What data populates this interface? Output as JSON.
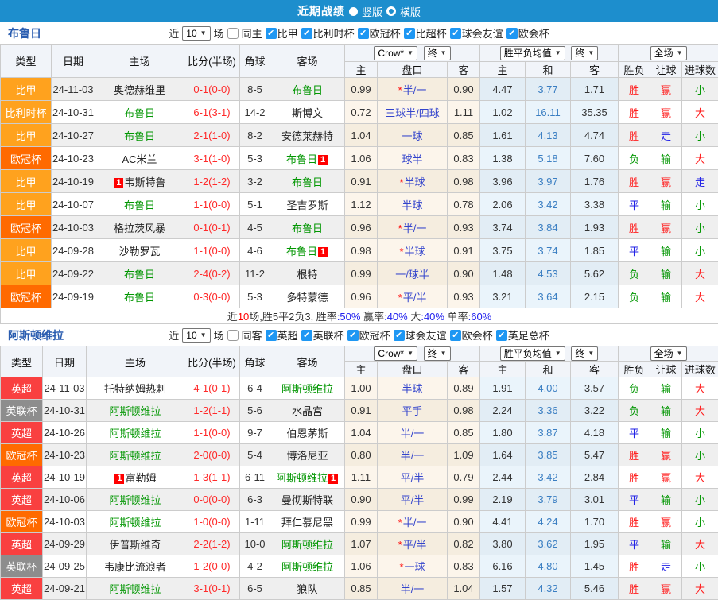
{
  "topbar": {
    "title": "近期战绩",
    "option_vertical": "竖版",
    "option_horizontal": "横版"
  },
  "labels": {
    "recent": "近",
    "games": "场"
  },
  "dropdowns": {
    "recent_count": "10",
    "bookmaker": "Crow*",
    "final": "终",
    "avg": "胜平负均值",
    "full_match": "全场"
  },
  "table_headers": {
    "type": "类型",
    "date": "日期",
    "home": "主场",
    "score": "比分(半场)",
    "corner": "角球",
    "away": "客场",
    "home_odds": "主",
    "handicap": "盘口",
    "away_odds": "客",
    "avg_home": "主",
    "avg_draw": "和",
    "avg_away": "客",
    "result": "胜负",
    "handicap_result": "让球",
    "goals": "进球数"
  },
  "colors": {
    "topbar_bg": "#1D8ECD",
    "competition": {
      "比甲": "#FFA21E",
      "比利时杯": "#FFA21E",
      "欧冠杯": "#FF6A00",
      "英超": "#F94040",
      "英联杯": "#8D8D8D"
    },
    "outcome": {
      "胜": "#FF1E1E",
      "平": "#1E1EE6",
      "负": "#009600",
      "赢": "#FF1E1E",
      "走": "#1E1EE6",
      "输": "#009600",
      "大": "#FF1E1E",
      "小": "#009600"
    }
  },
  "sections": [
    {
      "team": "布鲁日",
      "same_venue_label": "同主",
      "leagues": [
        "比甲",
        "比利时杯",
        "欧冠杯",
        "比超杯",
        "球会友谊",
        "欧会杯"
      ],
      "rows": [
        {
          "type": "比甲",
          "date": "24-11-03",
          "home": "奥德赫维里",
          "home_green": false,
          "score": "0-1(0-0)",
          "corner": "8-5",
          "away": "布鲁日",
          "away_green": true,
          "h": "0.99",
          "hcap_star": "*",
          "hcap": "半/一",
          "a": "0.90",
          "w": "4.47",
          "d": "3.77",
          "l": "1.71",
          "result": "胜",
          "spread": "赢",
          "ou": "小"
        },
        {
          "type": "比利时杯",
          "date": "24-10-31",
          "home": "布鲁日",
          "home_green": true,
          "score": "6-1(3-1)",
          "corner": "14-2",
          "away": "斯博文",
          "away_green": false,
          "h": "0.72",
          "hcap": "三球半/四球",
          "a": "1.11",
          "w": "1.02",
          "d": "16.11",
          "l": "35.35",
          "result": "胜",
          "spread": "赢",
          "ou": "大"
        },
        {
          "type": "比甲",
          "date": "24-10-27",
          "home": "布鲁日",
          "home_green": true,
          "score": "2-1(1-0)",
          "corner": "8-2",
          "away": "安德莱赫特",
          "away_green": false,
          "h": "1.04",
          "hcap": "一球",
          "a": "0.85",
          "w": "1.61",
          "d": "4.13",
          "l": "4.74",
          "result": "胜",
          "spread": "走",
          "ou": "小"
        },
        {
          "type": "欧冠杯",
          "date": "24-10-23",
          "home": "AC米兰",
          "home_green": false,
          "score": "3-1(1-0)",
          "corner": "5-3",
          "away": "布鲁日",
          "away_green": true,
          "away_badge": "1",
          "h": "1.06",
          "hcap": "球半",
          "a": "0.83",
          "w": "1.38",
          "d": "5.18",
          "l": "7.60",
          "result": "负",
          "spread": "输",
          "ou": "大"
        },
        {
          "type": "比甲",
          "date": "24-10-19",
          "home": "韦斯特鲁",
          "home_green": false,
          "home_badge": "1",
          "score": "1-2(1-2)",
          "corner": "3-2",
          "away": "布鲁日",
          "away_green": true,
          "h": "0.91",
          "hcap_star": "*",
          "hcap": "半球",
          "a": "0.98",
          "w": "3.96",
          "d": "3.97",
          "l": "1.76",
          "result": "胜",
          "spread": "赢",
          "ou": "走"
        },
        {
          "type": "比甲",
          "date": "24-10-07",
          "home": "布鲁日",
          "home_green": true,
          "score": "1-1(0-0)",
          "corner": "5-1",
          "away": "圣吉罗斯",
          "away_green": false,
          "h": "1.12",
          "hcap": "半球",
          "a": "0.78",
          "w": "2.06",
          "d": "3.42",
          "l": "3.38",
          "result": "平",
          "spread": "输",
          "ou": "小"
        },
        {
          "type": "欧冠杯",
          "date": "24-10-03",
          "home": "格拉茨风暴",
          "home_green": false,
          "score": "0-1(0-1)",
          "corner": "4-5",
          "away": "布鲁日",
          "away_green": true,
          "h": "0.96",
          "hcap_star": "*",
          "hcap": "半/一",
          "a": "0.93",
          "w": "3.74",
          "d": "3.84",
          "l": "1.93",
          "result": "胜",
          "spread": "赢",
          "ou": "小"
        },
        {
          "type": "比甲",
          "date": "24-09-28",
          "home": "沙勒罗瓦",
          "home_green": false,
          "score": "1-1(0-0)",
          "corner": "4-6",
          "away": "布鲁日",
          "away_green": true,
          "away_badge": "1",
          "h": "0.98",
          "hcap_star": "*",
          "hcap": "半球",
          "a": "0.91",
          "w": "3.75",
          "d": "3.74",
          "l": "1.85",
          "result": "平",
          "spread": "输",
          "ou": "小"
        },
        {
          "type": "比甲",
          "date": "24-09-22",
          "home": "布鲁日",
          "home_green": true,
          "score": "2-4(0-2)",
          "corner": "11-2",
          "away": "根特",
          "away_green": false,
          "h": "0.99",
          "hcap": "一/球半",
          "a": "0.90",
          "w": "1.48",
          "d": "4.53",
          "l": "5.62",
          "result": "负",
          "spread": "输",
          "ou": "大"
        },
        {
          "type": "欧冠杯",
          "date": "24-09-19",
          "home": "布鲁日",
          "home_green": true,
          "score": "0-3(0-0)",
          "corner": "5-3",
          "away": "多特蒙德",
          "away_green": false,
          "h": "0.96",
          "hcap_star": "*",
          "hcap": "平/半",
          "a": "0.93",
          "w": "3.21",
          "d": "3.64",
          "l": "2.15",
          "result": "负",
          "spread": "输",
          "ou": "大"
        }
      ],
      "summary": [
        {
          "text": "近",
          "color": "#333333"
        },
        {
          "text": "10",
          "color": "#FF0000"
        },
        {
          "text": "场,胜5平2负3, 胜率",
          "color": "#333333"
        },
        {
          "text": ":50%",
          "color": "#2222EE"
        },
        {
          "text": " 赢率",
          "color": "#333333"
        },
        {
          "text": ":40%",
          "color": "#2222EE"
        },
        {
          "text": " 大",
          "color": "#333333"
        },
        {
          "text": ":40%",
          "color": "#2222EE"
        },
        {
          "text": " 单率",
          "color": "#333333"
        },
        {
          "text": ":60%",
          "color": "#2222EE"
        }
      ]
    },
    {
      "team": "阿斯顿维拉",
      "same_venue_label": "同客",
      "leagues": [
        "英超",
        "英联杯",
        "欧冠杯",
        "球会友谊",
        "欧会杯",
        "英足总杯"
      ],
      "rows": [
        {
          "type": "英超",
          "date": "24-11-03",
          "home": "托特纳姆热刺",
          "home_green": false,
          "score": "4-1(0-1)",
          "corner": "6-4",
          "away": "阿斯顿维拉",
          "away_green": true,
          "h": "1.00",
          "hcap": "半球",
          "a": "0.89",
          "w": "1.91",
          "d": "4.00",
          "l": "3.57",
          "result": "负",
          "spread": "输",
          "ou": "大"
        },
        {
          "type": "英联杯",
          "date": "24-10-31",
          "home": "阿斯顿维拉",
          "home_green": true,
          "score": "1-2(1-1)",
          "corner": "5-6",
          "away": "水晶宫",
          "away_green": false,
          "h": "0.91",
          "hcap": "平手",
          "a": "0.98",
          "w": "2.24",
          "d": "3.36",
          "l": "3.22",
          "result": "负",
          "spread": "输",
          "ou": "大"
        },
        {
          "type": "英超",
          "date": "24-10-26",
          "home": "阿斯顿维拉",
          "home_green": true,
          "score": "1-1(0-0)",
          "corner": "9-7",
          "away": "伯恩茅斯",
          "away_green": false,
          "h": "1.04",
          "hcap": "半/一",
          "a": "0.85",
          "w": "1.80",
          "d": "3.87",
          "l": "4.18",
          "result": "平",
          "spread": "输",
          "ou": "小"
        },
        {
          "type": "欧冠杯",
          "date": "24-10-23",
          "home": "阿斯顿维拉",
          "home_green": true,
          "score": "2-0(0-0)",
          "corner": "5-4",
          "away": "博洛尼亚",
          "away_green": false,
          "h": "0.80",
          "hcap": "半/一",
          "a": "1.09",
          "w": "1.64",
          "d": "3.85",
          "l": "5.47",
          "result": "胜",
          "spread": "赢",
          "ou": "小"
        },
        {
          "type": "英超",
          "date": "24-10-19",
          "home": "富勒姆",
          "home_green": false,
          "home_badge": "1",
          "score": "1-3(1-1)",
          "corner": "6-11",
          "away": "阿斯顿维拉",
          "away_green": true,
          "away_badge": "1",
          "h": "1.11",
          "hcap": "平/半",
          "a": "0.79",
          "w": "2.44",
          "d": "3.42",
          "l": "2.84",
          "result": "胜",
          "spread": "赢",
          "ou": "大"
        },
        {
          "type": "英超",
          "date": "24-10-06",
          "home": "阿斯顿维拉",
          "home_green": true,
          "score": "0-0(0-0)",
          "corner": "6-3",
          "away": "曼彻斯特联",
          "away_green": false,
          "h": "0.90",
          "hcap": "平/半",
          "a": "0.99",
          "w": "2.19",
          "d": "3.79",
          "l": "3.01",
          "result": "平",
          "spread": "输",
          "ou": "小"
        },
        {
          "type": "欧冠杯",
          "date": "24-10-03",
          "home": "阿斯顿维拉",
          "home_green": true,
          "score": "1-0(0-0)",
          "corner": "1-11",
          "away": "拜仁慕尼黑",
          "away_green": false,
          "h": "0.99",
          "hcap_star": "*",
          "hcap": "半/一",
          "a": "0.90",
          "w": "4.41",
          "d": "4.24",
          "l": "1.70",
          "result": "胜",
          "spread": "赢",
          "ou": "小"
        },
        {
          "type": "英超",
          "date": "24-09-29",
          "home": "伊普斯维奇",
          "home_green": false,
          "score": "2-2(1-2)",
          "corner": "10-0",
          "away": "阿斯顿维拉",
          "away_green": true,
          "h": "1.07",
          "hcap_star": "*",
          "hcap": "平/半",
          "a": "0.82",
          "w": "3.80",
          "d": "3.62",
          "l": "1.95",
          "result": "平",
          "spread": "输",
          "ou": "大"
        },
        {
          "type": "英联杯",
          "date": "24-09-25",
          "home": "韦康比流浪者",
          "home_green": false,
          "score": "1-2(0-0)",
          "corner": "4-2",
          "away": "阿斯顿维拉",
          "away_green": true,
          "h": "1.06",
          "hcap_star": "*",
          "hcap": "一球",
          "a": "0.83",
          "w": "6.16",
          "d": "4.80",
          "l": "1.45",
          "result": "胜",
          "spread": "走",
          "ou": "小"
        },
        {
          "type": "英超",
          "date": "24-09-21",
          "home": "阿斯顿维拉",
          "home_green": true,
          "score": "3-1(0-1)",
          "corner": "6-5",
          "away": "狼队",
          "away_green": false,
          "h": "0.85",
          "hcap": "半/一",
          "a": "1.04",
          "w": "1.57",
          "d": "4.32",
          "l": "5.46",
          "result": "胜",
          "spread": "赢",
          "ou": "大"
        }
      ]
    }
  ]
}
